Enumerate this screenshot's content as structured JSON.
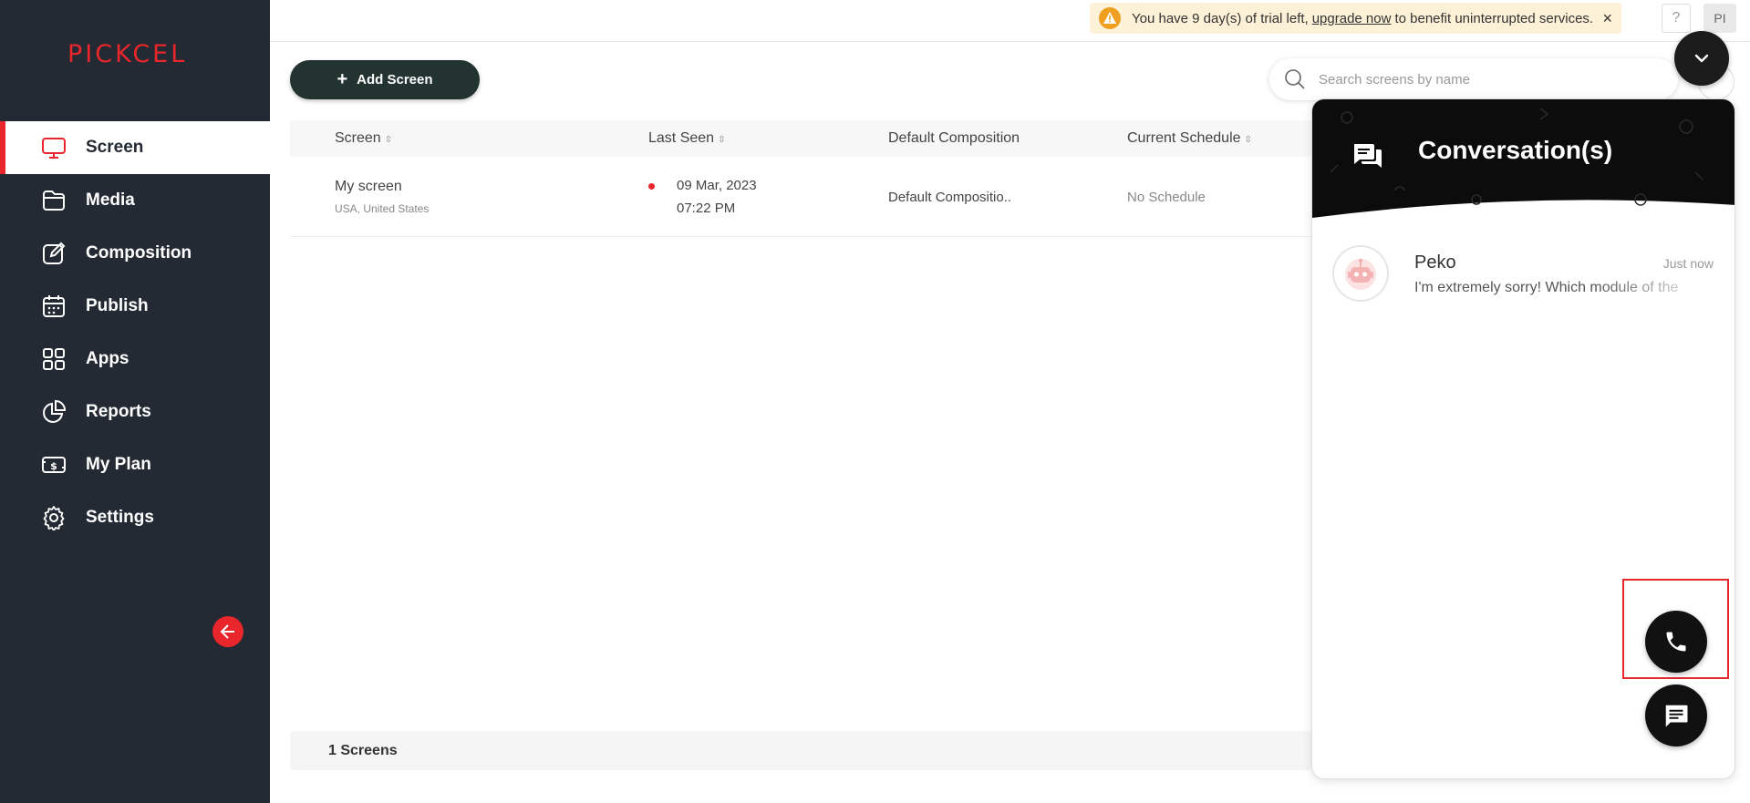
{
  "app": {
    "logo_text": "PICKCEL",
    "brand_color": "#e8262c",
    "sidebar_color": "#232a33"
  },
  "sidebar": {
    "items": [
      {
        "label": "Screen",
        "icon": "monitor-icon",
        "active": true
      },
      {
        "label": "Media",
        "icon": "folder-icon",
        "active": false
      },
      {
        "label": "Composition",
        "icon": "edit-icon",
        "active": false
      },
      {
        "label": "Publish",
        "icon": "calendar-icon",
        "active": false
      },
      {
        "label": "Apps",
        "icon": "apps-grid-icon",
        "active": false
      },
      {
        "label": "Reports",
        "icon": "pie-chart-icon",
        "active": false
      },
      {
        "label": "My Plan",
        "icon": "dollar-bill-icon",
        "active": false
      },
      {
        "label": "Settings",
        "icon": "gear-icon",
        "active": false
      }
    ],
    "collapse_icon": "arrow-left-icon"
  },
  "topbar": {
    "trial_prefix": "You have 9 day(s) of trial left,",
    "trial_link": "upgrade now",
    "trial_suffix": "to benefit uninterrupted services.",
    "close_label": "×",
    "help_label": "?",
    "avatar_label": "PI"
  },
  "toolbar": {
    "add_label": "Add Screen",
    "add_plus": "+",
    "search_placeholder": "Search screens by name"
  },
  "table": {
    "columns": [
      "Screen",
      "Last Seen",
      "Default Composition",
      "Current Schedule"
    ],
    "rows": [
      {
        "name": "My screen",
        "location": "USA, United States",
        "last_seen_date": "09 Mar, 2023",
        "last_seen_time": "07:22 PM",
        "composition": "Default Compositio..",
        "schedule": "No Schedule",
        "status_color": "#e8262c"
      }
    ]
  },
  "footer": {
    "count_label": "1 Screens"
  },
  "chat": {
    "title": "Conversation(s)",
    "conversations": [
      {
        "name": "Peko",
        "time": "Just now",
        "message": "I'm extremely sorry! Which module of the"
      }
    ]
  }
}
